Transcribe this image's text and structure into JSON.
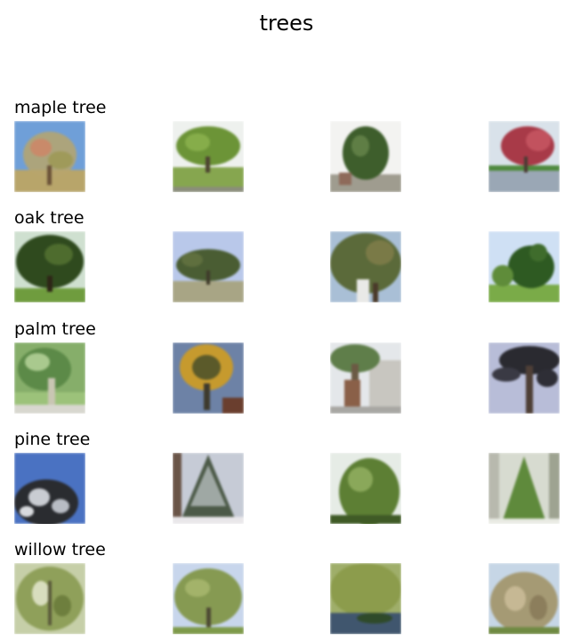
{
  "figure": {
    "title": "trees"
  },
  "rows": [
    {
      "label": "maple tree",
      "images": [
        "maple-tree-1",
        "maple-tree-2",
        "maple-tree-3",
        "maple-tree-4"
      ]
    },
    {
      "label": "oak tree",
      "images": [
        "oak-tree-1",
        "oak-tree-2",
        "oak-tree-3",
        "oak-tree-4"
      ]
    },
    {
      "label": "palm tree",
      "images": [
        "palm-tree-1",
        "palm-tree-2",
        "palm-tree-3",
        "palm-tree-4"
      ]
    },
    {
      "label": "pine tree",
      "images": [
        "pine-tree-1",
        "pine-tree-2",
        "pine-tree-3",
        "pine-tree-4"
      ]
    },
    {
      "label": "willow tree",
      "images": [
        "willow-tree-1",
        "willow-tree-2",
        "willow-tree-3",
        "willow-tree-4"
      ]
    }
  ]
}
